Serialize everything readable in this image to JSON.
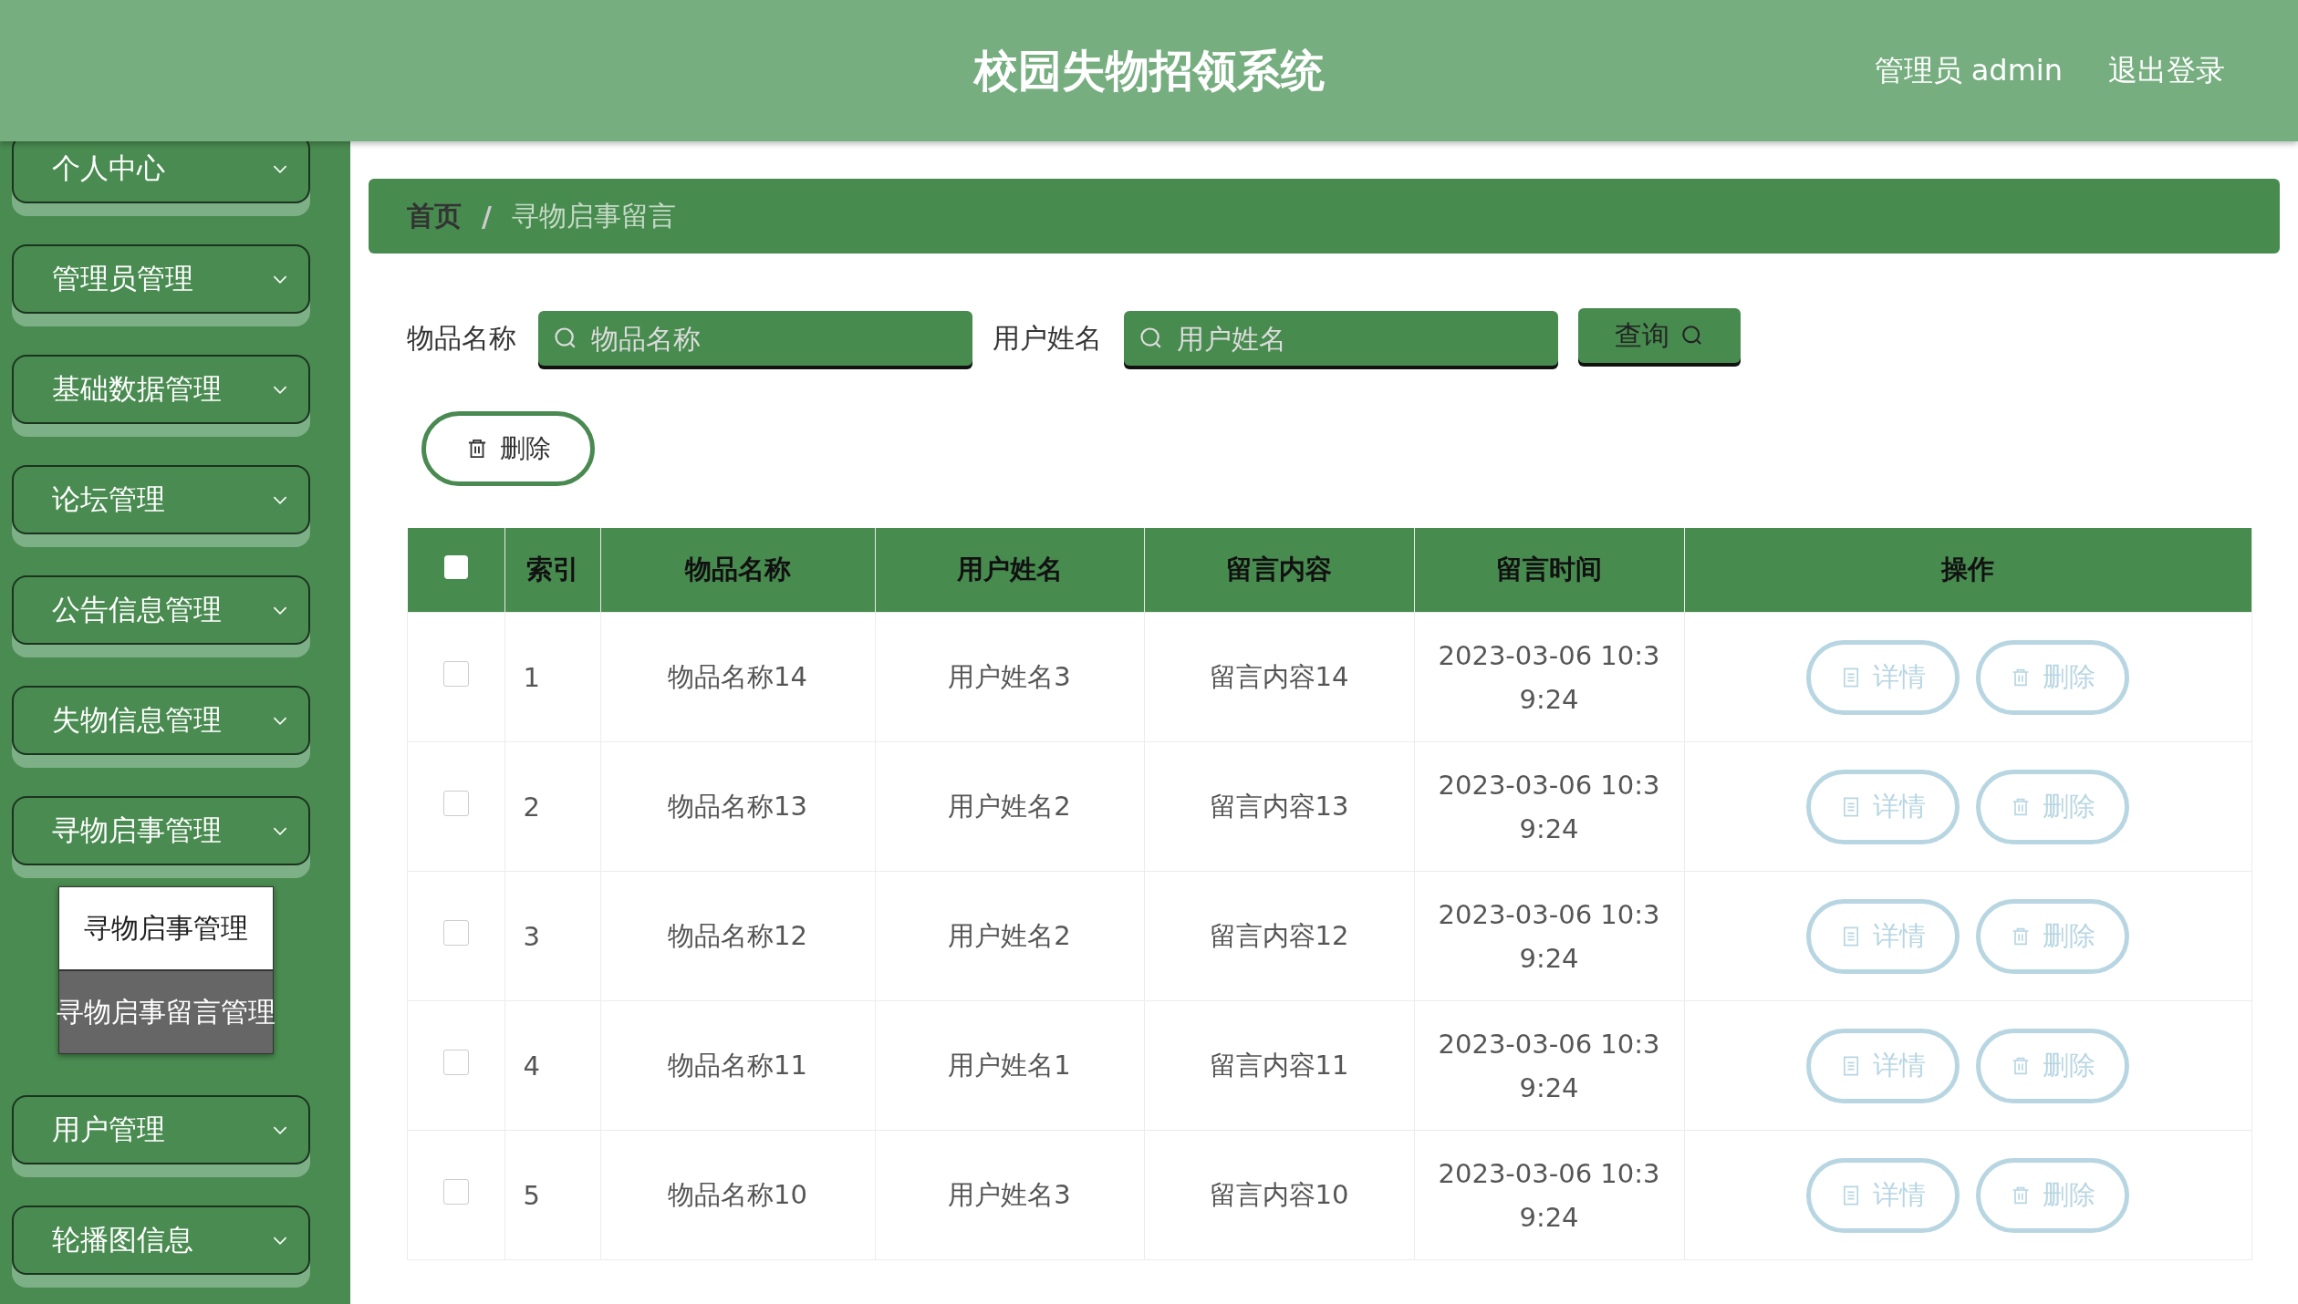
{
  "header": {
    "title": "校园失物招领系统",
    "user": "管理员 admin",
    "logout": "退出登录"
  },
  "sidebar": {
    "items": [
      {
        "label": "个人中心"
      },
      {
        "label": "管理员管理"
      },
      {
        "label": "基础数据管理"
      },
      {
        "label": "论坛管理"
      },
      {
        "label": "公告信息管理"
      },
      {
        "label": "失物信息管理"
      },
      {
        "label": "寻物启事管理",
        "children": [
          {
            "label": "寻物启事管理",
            "selected": false
          },
          {
            "label": "寻物启事留言管理",
            "selected": true
          }
        ]
      },
      {
        "label": "用户管理"
      },
      {
        "label": "轮播图信息"
      }
    ]
  },
  "breadcrumb": {
    "items": [
      {
        "label": "首页",
        "current": false
      },
      {
        "label": "寻物启事留言",
        "current": true
      }
    ],
    "separator": "/"
  },
  "search": {
    "fields": [
      {
        "label": "物品名称",
        "placeholder": "物品名称"
      },
      {
        "label": "用户姓名",
        "placeholder": "用户姓名"
      }
    ],
    "button": "查询"
  },
  "delete_button": "删除",
  "table": {
    "all_checked": false,
    "columns": [
      "索引",
      "物品名称",
      "用户姓名",
      "留言内容",
      "留言时间",
      "操作"
    ],
    "rows": [
      {
        "checked": false,
        "cells": [
          "1",
          "物品名称14",
          "用户姓名3",
          "留言内容14",
          "2023-03-06 10:39:24"
        ],
        "actions": [
          "详情",
          "删除"
        ]
      },
      {
        "checked": false,
        "cells": [
          "2",
          "物品名称13",
          "用户姓名2",
          "留言内容13",
          "2023-03-06 10:39:24"
        ],
        "actions": [
          "详情",
          "删除"
        ]
      },
      {
        "checked": false,
        "cells": [
          "3",
          "物品名称12",
          "用户姓名2",
          "留言内容12",
          "2023-03-06 10:39:24"
        ],
        "actions": [
          "详情",
          "删除"
        ]
      },
      {
        "checked": false,
        "cells": [
          "4",
          "物品名称11",
          "用户姓名1",
          "留言内容11",
          "2023-03-06 10:39:24"
        ],
        "actions": [
          "详情",
          "删除"
        ]
      },
      {
        "checked": false,
        "cells": [
          "5",
          "物品名称10",
          "用户姓名3",
          "留言内容10",
          "2023-03-06 10:39:24"
        ],
        "actions": [
          "详情",
          "删除"
        ]
      }
    ]
  }
}
